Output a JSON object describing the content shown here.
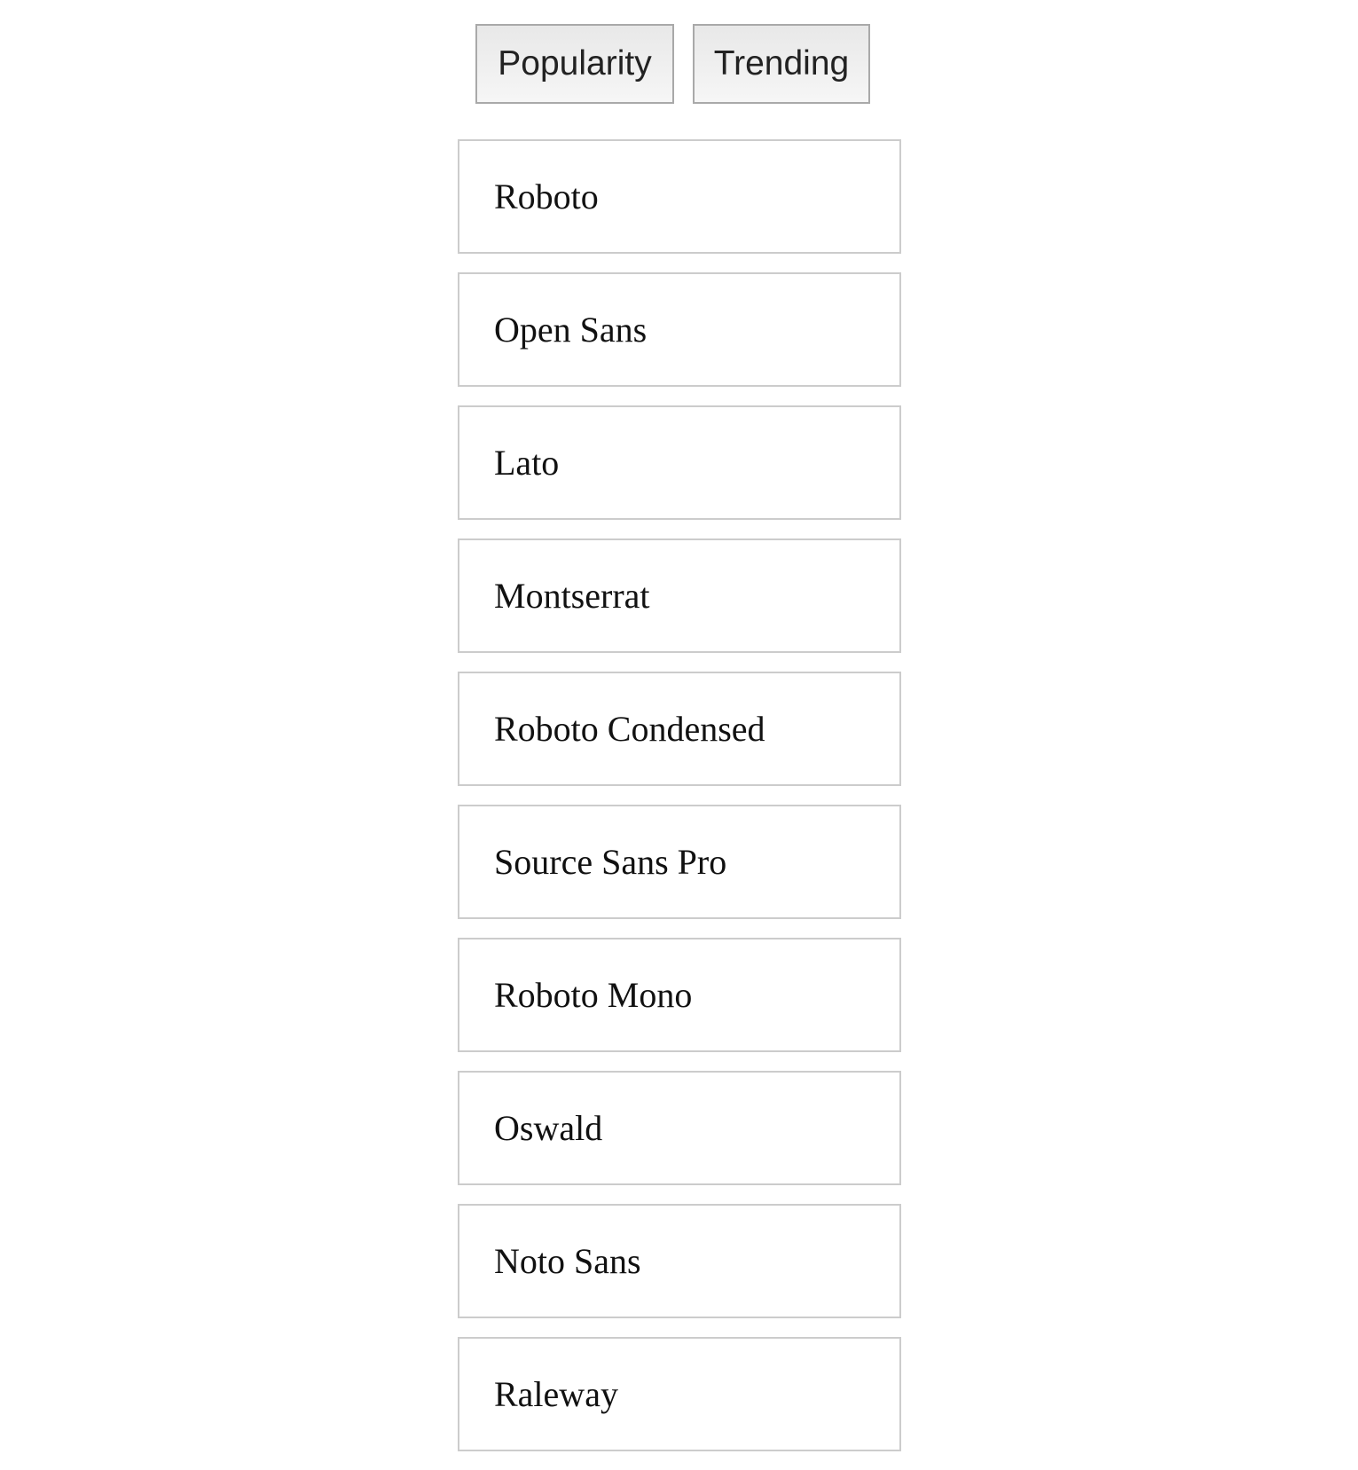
{
  "toolbar": {
    "buttons": [
      {
        "label": "Popularity"
      },
      {
        "label": "Trending"
      }
    ]
  },
  "font_list": {
    "items": [
      {
        "name": "Roboto"
      },
      {
        "name": "Open Sans"
      },
      {
        "name": "Lato"
      },
      {
        "name": "Montserrat"
      },
      {
        "name": "Roboto Condensed"
      },
      {
        "name": "Source Sans Pro"
      },
      {
        "name": "Roboto Mono"
      },
      {
        "name": "Oswald"
      },
      {
        "name": "Noto Sans"
      },
      {
        "name": "Raleway"
      }
    ]
  }
}
